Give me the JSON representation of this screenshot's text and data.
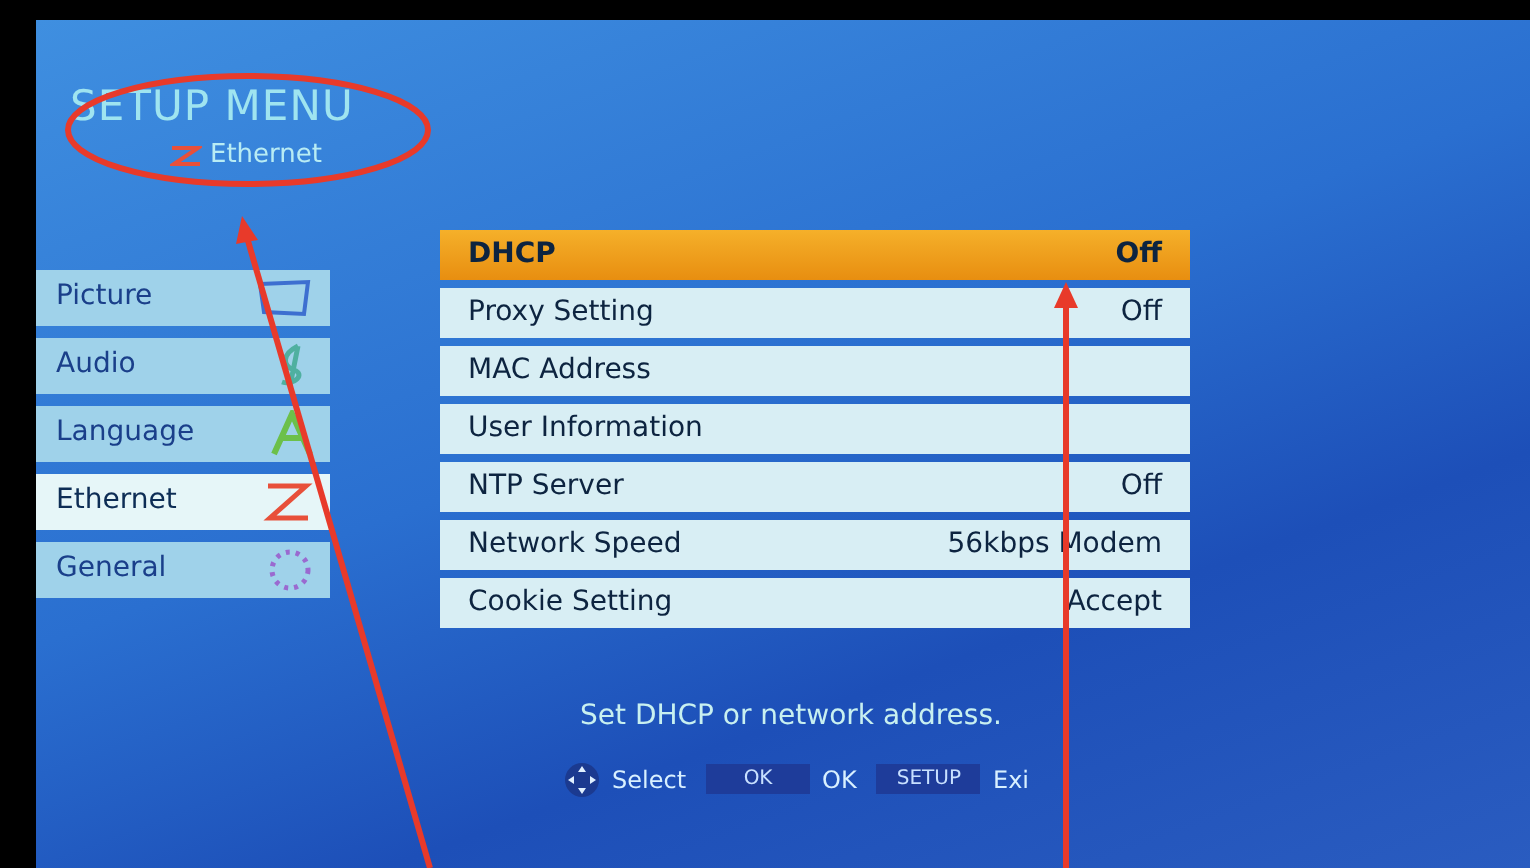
{
  "header": {
    "title": "SETUP MENU",
    "subtitle": "Ethernet"
  },
  "categories": [
    {
      "label": "Picture",
      "kind": "picture",
      "selected": false
    },
    {
      "label": "Audio",
      "kind": "audio",
      "selected": false
    },
    {
      "label": "Language",
      "kind": "language",
      "selected": false
    },
    {
      "label": "Ethernet",
      "kind": "ethernet",
      "selected": true
    },
    {
      "label": "General",
      "kind": "general",
      "selected": false
    }
  ],
  "settings": [
    {
      "label": "DHCP",
      "value": "Off",
      "selected": true
    },
    {
      "label": "Proxy Setting",
      "value": "Off",
      "selected": false
    },
    {
      "label": "MAC Address",
      "selected": false
    },
    {
      "label": "User Information",
      "selected": false
    },
    {
      "label": "NTP Server",
      "value": "Off",
      "selected": false
    },
    {
      "label": "Network Speed",
      "value": "56kbps Modem",
      "selected": false
    },
    {
      "label": "Cookie Setting",
      "value": "Accept",
      "selected": false
    }
  ],
  "help_text": "Set DHCP or network address.",
  "footer": [
    {
      "kind": "dpad",
      "label": "Select"
    },
    {
      "kind": "key",
      "key": "OK",
      "label": "OK"
    },
    {
      "kind": "key",
      "key": "SETUP",
      "label": "Exi"
    }
  ]
}
